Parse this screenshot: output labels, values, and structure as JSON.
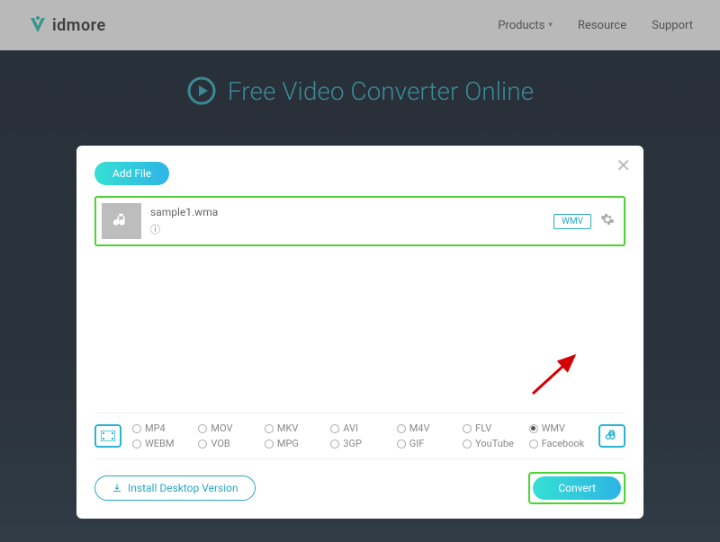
{
  "header": {
    "brand": "idmore",
    "nav": {
      "products": "Products",
      "resource": "Resource",
      "support": "Support"
    }
  },
  "hero": {
    "title": "Free Video Converter Online"
  },
  "modal": {
    "add_file": "Add File",
    "file": {
      "name": "sample1.wma",
      "format_tag": "WMV"
    },
    "formats_row1": [
      "MP4",
      "MOV",
      "MKV",
      "AVI",
      "M4V",
      "FLV",
      "WMV"
    ],
    "formats_row2": [
      "WEBM",
      "VOB",
      "MPG",
      "3GP",
      "GIF",
      "YouTube",
      "Facebook"
    ],
    "selected_format": "WMV",
    "install": "Install Desktop Version",
    "convert": "Convert"
  }
}
